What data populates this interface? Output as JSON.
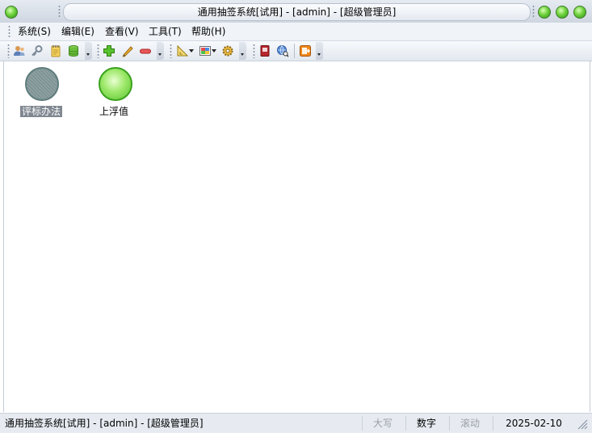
{
  "window": {
    "title": "通用抽签系统[试用]  - [admin] - [超级管理员]"
  },
  "menu": {
    "items": [
      {
        "label": "系统(S)"
      },
      {
        "label": "编辑(E)"
      },
      {
        "label": "查看(V)"
      },
      {
        "label": "工具(T)"
      },
      {
        "label": "帮助(H)"
      }
    ]
  },
  "toolbar": {
    "icons": [
      "users-icon",
      "key-icon",
      "notepad-icon",
      "database-icon",
      "add-icon",
      "pencil-icon",
      "remove-icon",
      "ruler-icon",
      "palette-icon",
      "settings-icon",
      "book-icon",
      "globe-search-icon",
      "exit-icon"
    ]
  },
  "desktop": {
    "items": [
      {
        "label": "评标办法",
        "icon": "gray-circle-icon",
        "selected": true
      },
      {
        "label": "上浮值",
        "icon": "green-circle-icon",
        "selected": false
      }
    ]
  },
  "status": {
    "text": "通用抽签系统[试用]  - [admin] - [超级管理员]",
    "caps": "大写",
    "num": "数字",
    "scroll": "滚动",
    "date": "2025-02-10"
  },
  "colors": {
    "accent_green": "#58c22e",
    "selection_gray": "#7f8790",
    "disabled_text": "#9aa0a8"
  }
}
